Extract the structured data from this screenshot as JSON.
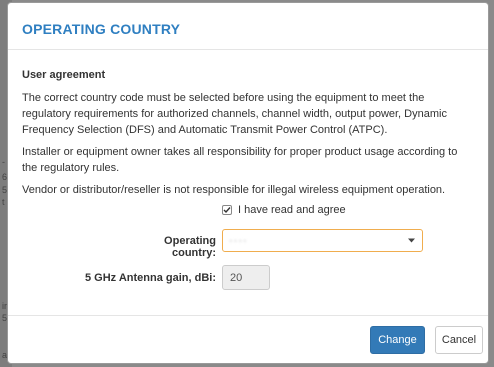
{
  "modal": {
    "title": "OPERATING COUNTRY",
    "section_title": "User agreement",
    "paragraphs": [
      "The correct country code must be selected before using the equipment to meet the regulatory requirements for authorized channels, channel width, output power, Dynamic Frequency Selection (DFS) and Automatic Transmit Power Control (ATPC).",
      "Installer or equipment owner takes all responsibility for proper product usage according to the regulatory rules.",
      "Vendor or distributor/reseller is not responsible for illegal wireless equipment operation."
    ],
    "agree": {
      "label": "I have read and agree",
      "checked": true
    },
    "country": {
      "label": "Operating country:",
      "value": "····"
    },
    "antenna_gain": {
      "label": "5 GHz Antenna gain, dBi:",
      "value": "20"
    },
    "buttons": {
      "primary": "Change",
      "secondary": "Cancel"
    }
  },
  "background": {
    "edge_text": [
      "-",
      "6",
      "5",
      "t",
      "ir",
      "5",
      "a"
    ]
  },
  "colors": {
    "title": "#2f7fc1",
    "primary_button": "#337ab7",
    "select_border": "#f0ad4e"
  }
}
